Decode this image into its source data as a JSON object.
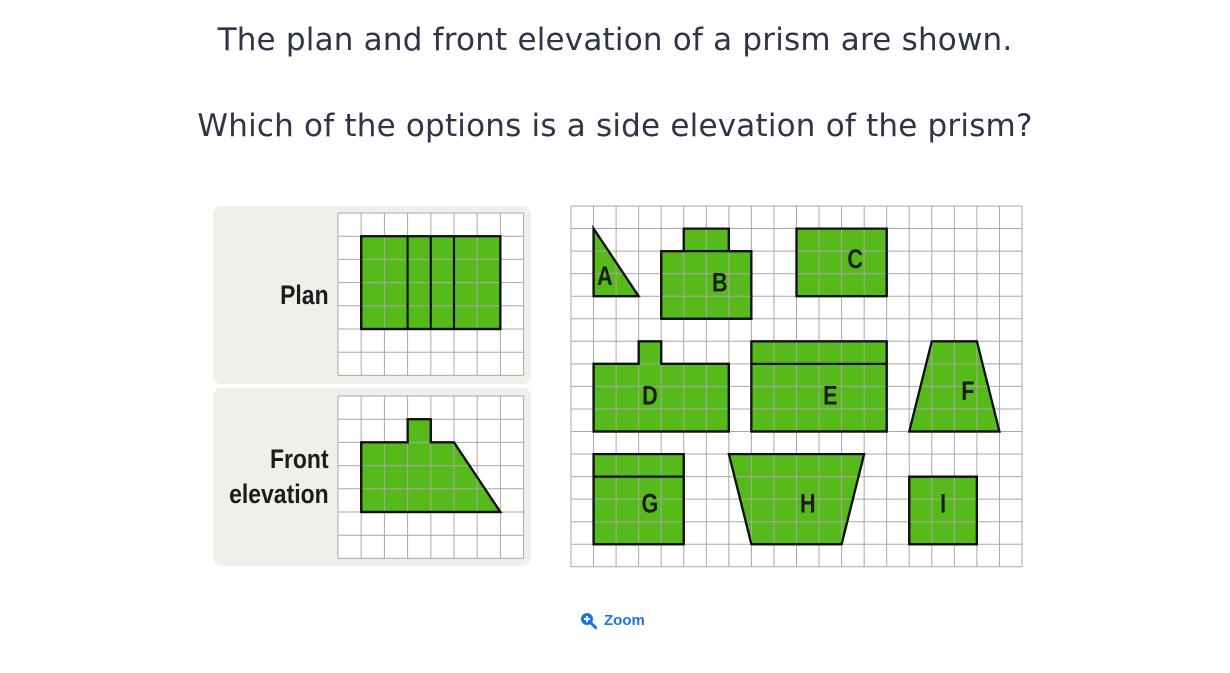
{
  "question": {
    "line1": "The plan and front elevation of a prism are shown.",
    "line2": "Which of the options is a side elevation of the prism?"
  },
  "given": {
    "plan_label": "Plan",
    "front_label_line1": "Front",
    "front_label_line2": "elevation"
  },
  "options": [
    "A",
    "B",
    "C",
    "D",
    "E",
    "F",
    "G",
    "H",
    "I"
  ],
  "zoom_label": "Zoom",
  "colors": {
    "shape_fill": "#56bb1a",
    "panel_bg": "#f1efe9",
    "grid": "#a8a8a8",
    "link": "#1a73e8"
  }
}
